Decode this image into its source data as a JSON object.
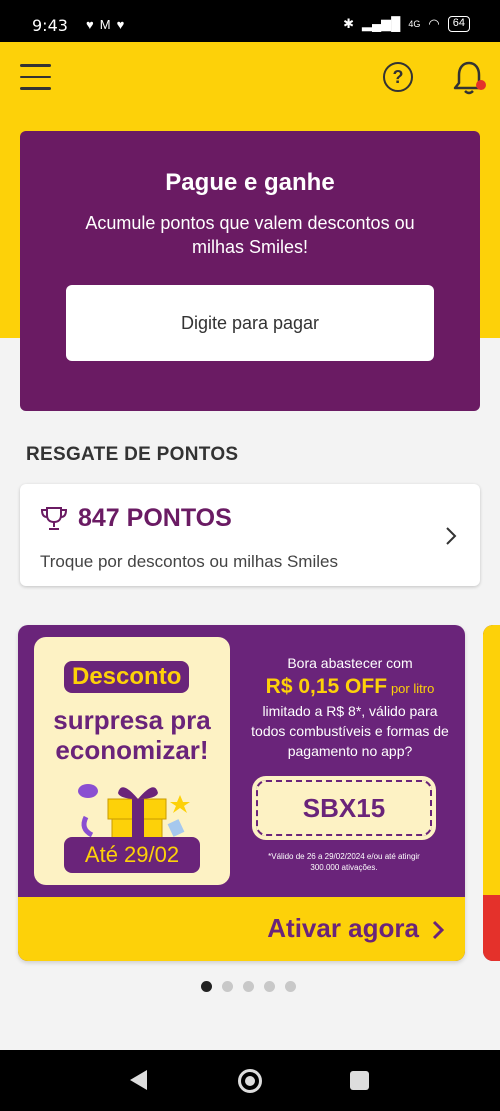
{
  "status_bar": {
    "time": "9:43",
    "network": "4G",
    "battery": "64"
  },
  "header": {
    "icons": [
      "menu-icon",
      "help-icon",
      "bell-icon"
    ],
    "help_symbol": "?",
    "bell_badge_color": "#e4312b"
  },
  "pay_card": {
    "title": "Pague e ganhe",
    "subtitle": "Acumule pontos que valem descontos ou milhas Smiles!",
    "button_label": "Digite para pagar"
  },
  "points_section": {
    "title": "RESGATE DE PONTOS",
    "points": "847 PONTOS",
    "description": "Troque por descontos ou milhas Smiles"
  },
  "promo_banner": {
    "tag": "Desconto",
    "headline_1": "surpresa pra",
    "headline_2": "economizar!",
    "date": "Até 29/02",
    "intro": "Bora abastecer com",
    "discount": "R$ 0,15 OFF",
    "per_unit": "por litro",
    "details": "limitado a R$ 8*, válido para todos combustíveis e formas de pagamento no app?",
    "coupon_code": "SBX15",
    "fineprint": "*Válido de 26 a 29/02/2024 e/ou até atingir 300.000 ativações.",
    "cta": "Ativar agora"
  },
  "carousel": {
    "total_dots": 5,
    "active_index": 0
  },
  "colors": {
    "brand_yellow": "#fdd109",
    "brand_purple": "#6a1b63",
    "promo_purple": "#6a247a"
  }
}
